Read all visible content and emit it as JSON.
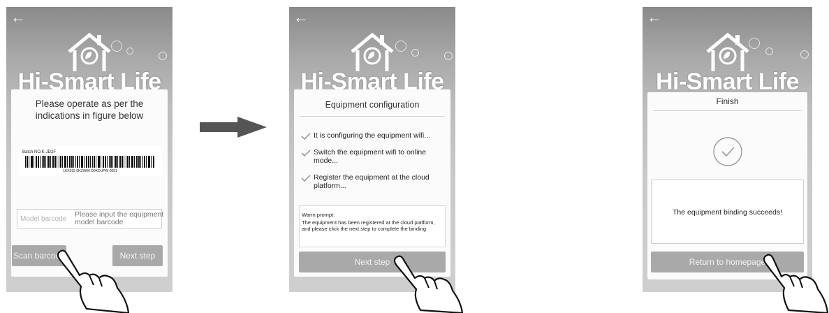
{
  "brand": "Hi-Smart Life",
  "icons": {
    "back": "back-arrow-icon",
    "logo": "house-leaf-logo-icon",
    "check": "check-icon",
    "hand": "pointing-hand-icon",
    "flow": "flow-arrow-icon"
  },
  "colors": {
    "button": "#a9a9a9",
    "card": "#fbfbfb",
    "background": "#c4c4c4"
  },
  "screen1": {
    "back": "←",
    "instruction": "Please operate as per the indications in figure below",
    "label_batch": "Batch NO.K-JD2F",
    "label_code": "1KK035 0KZW00 D0KDUPW 0001",
    "input_placeholder_left": "Model barcode",
    "input_placeholder_right": "Please input the equipment model barcode",
    "scan_button": "Scan barcode",
    "next_button": "Next step"
  },
  "screen2": {
    "back": "←",
    "title": "Equipment configuration",
    "steps": [
      "It is configuring the equipment wifi...",
      "Switch the equipment wifi to online mode...",
      "Register the equipment at the cloud platform..."
    ],
    "warn_title": "Warm prompt:",
    "warn_body": "The equipment has been registered at the cloud platform, and please click the next step to complete the binding",
    "next_button": "Next step"
  },
  "screen3": {
    "back": "←",
    "title": "Finish",
    "message": "The equipment binding succeeds!",
    "return_button": "Return to homepage"
  }
}
